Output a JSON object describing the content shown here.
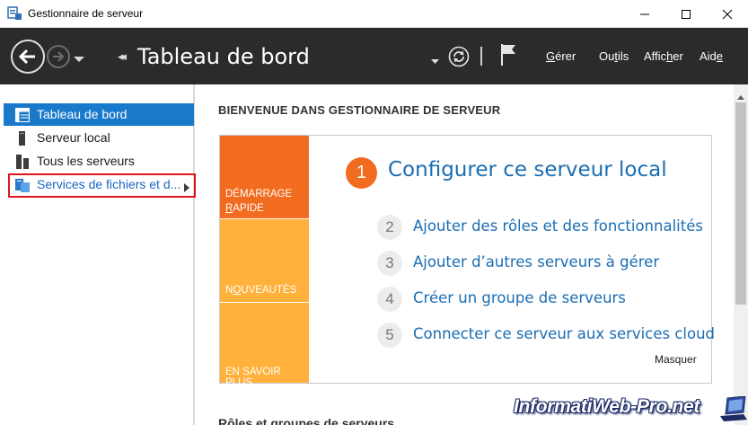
{
  "window": {
    "title": "Gestionnaire de serveur"
  },
  "toolbar": {
    "breadcrumb_title": "Tableau de bord",
    "menu": [
      {
        "label": "Gérer",
        "ul": "G",
        "rest": "érer"
      },
      {
        "label": "Outils",
        "pre": "Ou",
        "ul": "t",
        "rest": "ils"
      },
      {
        "label": "Afficher",
        "pre": "Affic",
        "ul": "h",
        "rest": "er"
      },
      {
        "label": "Aide",
        "pre": "Aid",
        "ul": "e",
        "rest": ""
      }
    ]
  },
  "sidebar": {
    "items": [
      {
        "label": "Tableau de bord",
        "icon": "dashboard-icon",
        "active": true
      },
      {
        "label": "Serveur local",
        "icon": "server-icon",
        "active": false
      },
      {
        "label": "Tous les serveurs",
        "icon": "servers-icon",
        "active": false
      },
      {
        "label": "Services de fichiers et d...",
        "icon": "file-services-icon",
        "active": false,
        "highlighted": true
      }
    ]
  },
  "main": {
    "welcome": "BIENVENUE DANS GESTIONNAIRE DE SERVEUR",
    "tiles": {
      "quick_start_line1": "DÉMARRAGE",
      "quick_start_line2_ul": "R",
      "quick_start_line2_rest": "APIDE",
      "whats_new_pre": "N",
      "whats_new_ul": "O",
      "whats_new_rest": "UVEAUTÉS",
      "learn_more_pre": "EN SAVOIR P",
      "learn_more_ul": "L",
      "learn_more_rest": "US"
    },
    "step_main": {
      "number": "1",
      "label": "Configurer ce serveur local"
    },
    "steps": [
      {
        "number": "2",
        "label": "Ajouter des rôles et des fonctionnalités"
      },
      {
        "number": "3",
        "label": "Ajouter d’autres serveurs à gérer"
      },
      {
        "number": "4",
        "label": "Créer un groupe de serveurs"
      },
      {
        "number": "5",
        "label": "Connecter ce serveur aux services cloud"
      }
    ],
    "hide_label": "Masquer",
    "roles_heading": "Rôles et groupes de serveurs"
  },
  "watermark": "InformatiWeb-Pro.net",
  "colors": {
    "toolbar_bg": "#2b2b2b",
    "sidebar_active": "#1979ca",
    "tile_orange": "#f26c20",
    "tile_amber": "#ffb13b",
    "link_blue": "#1a6db3",
    "highlight_red": "#e0161c"
  }
}
